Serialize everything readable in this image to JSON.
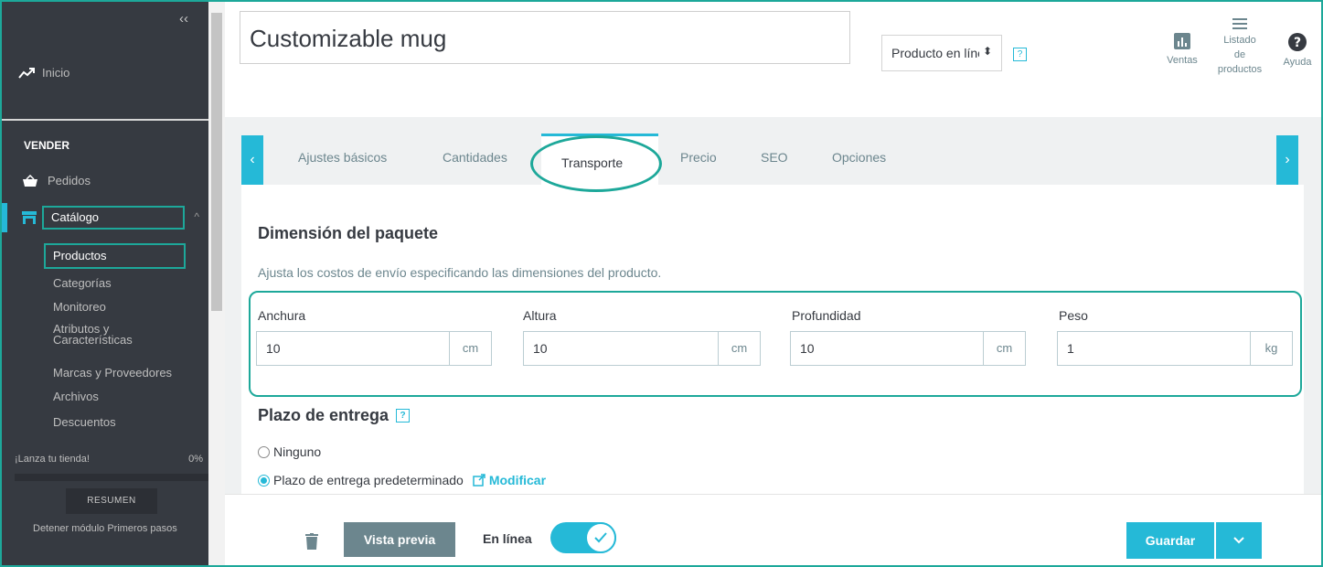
{
  "sidebar": {
    "collapse_label": "‹‹",
    "home_label": "Inicio",
    "section_label": "VENDER",
    "orders_label": "Pedidos",
    "catalog_label": "Catálogo",
    "catalog_items": [
      "Productos",
      "Categorías",
      "Monitoreo",
      "Atributos y\nCaracterísticas",
      "Marcas y Proveedores",
      "Archivos",
      "Descuentos"
    ],
    "launch_label": "¡Lanza tu tienda!",
    "launch_percent": "0%",
    "summary_button": "RESUMEN",
    "stop_module": "Detener módulo Primeros pasos"
  },
  "header": {
    "product_name": "Customizable mug",
    "status_select": "Producto en línea",
    "help_glyph": "?",
    "sales_label": "Ventas",
    "product_list_label": "Listado\nde\nproductos",
    "help_label": "Ayuda"
  },
  "tabs": {
    "items": [
      "Ajustes básicos",
      "Cantidades",
      "Transporte",
      "Precio",
      "SEO",
      "Opciones"
    ],
    "active_index": 2,
    "prev_glyph": "‹",
    "next_glyph": "›"
  },
  "shipping": {
    "package_title": "Dimensión del paquete",
    "package_description": "Ajusta los costos de envío especificando las dimensiones del producto.",
    "fields": [
      {
        "label": "Anchura",
        "value": "10",
        "unit": "cm"
      },
      {
        "label": "Altura",
        "value": "10",
        "unit": "cm"
      },
      {
        "label": "Profundidad",
        "value": "10",
        "unit": "cm"
      },
      {
        "label": "Peso",
        "value": "1",
        "unit": "kg"
      }
    ],
    "delivery_title": "Plazo de entrega",
    "option_none": "Ninguno",
    "option_default": "Plazo de entrega predeterminado",
    "modify_link": "Modificar"
  },
  "footer": {
    "preview_button": "Vista previa",
    "online_label": "En línea",
    "online_enabled": true,
    "save_button": "Guardar"
  },
  "colors": {
    "sidebar_bg": "#363a41",
    "accent": "#25b9d7",
    "highlight": "#1da89a"
  }
}
